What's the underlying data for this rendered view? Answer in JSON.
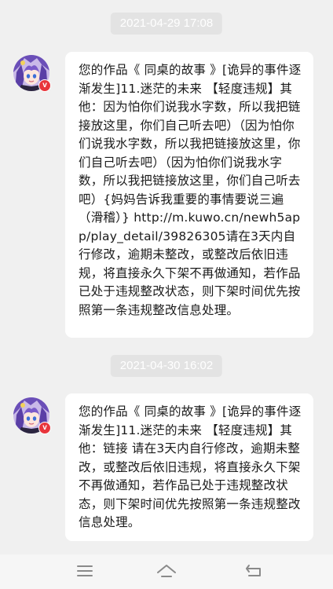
{
  "messages": [
    {
      "timestamp": "2021-04-29 17:08",
      "text": "您的作品《 同桌的故事 》[诡异的事件逐渐发生]11.迷茫的未来 【轻度违规】其他：因为怕你们说我水字数，所以我把链接放这里，你们自己听去吧）（因为怕你们说我水字数，所以我把链接放这里，你们自己听去吧）（因为怕你们说我水字数，所以我把链接放这里，你们自己听去吧）{妈妈告诉我重要的事情要说三遍（滑稽）} http://m.kuwo.cn/newh5app/play_detail/39826305请在3天内自行修改，逾期未整改，或整改后依旧违规，将直接永久下架不再做通知，若作品已处于违规整改状态，则下架时间优先按照第一条违规整改信息处理。",
      "avatar_badge": "v"
    },
    {
      "timestamp": "2021-04-30 16:02",
      "text": "您的作品《 同桌的故事 》[诡异的事件逐渐发生]11.迷茫的未来 【轻度违规】其他：链接 请在3天内自行修改，逾期未整改，或整改后依旧违规，将直接永久下架不再做通知，若作品已处于违规整改状态，则下架时间优先按照第一条违规整改信息处理。",
      "avatar_badge": "v"
    }
  ],
  "nav": {
    "menu_icon": "menu-icon",
    "home_icon": "home-icon",
    "back_icon": "back-icon"
  },
  "colors": {
    "background": "#f0f0f0",
    "bubble": "#ffffff",
    "timestamp_bg": "#e3e3e3",
    "badge": "#e8353b"
  }
}
